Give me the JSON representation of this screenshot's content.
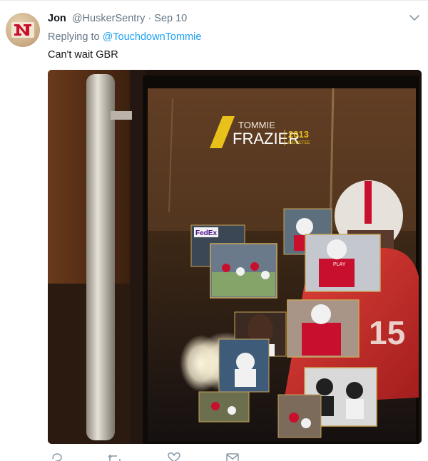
{
  "tweet": {
    "display_name": "Jon",
    "handle": "@HuskerSentry",
    "separator": "·",
    "date": "Sep 10",
    "replying_prefix": "Replying to",
    "replying_to": "@TouchdownTommie",
    "text": "Can't wait GBR"
  },
  "media": {
    "plaque": {
      "first_name": "TOMMIE",
      "last_name": "FRAZIER",
      "year": "2013",
      "inductee": "INDUCTEE"
    },
    "sign_text": "FedEx",
    "jersey_number": "15",
    "helmet_text": "PLAY"
  },
  "colors": {
    "link_blue": "#1da1f2",
    "secondary_gray": "#657786",
    "husker_red": "#c8102e",
    "plaque_gold": "#e8c21a"
  },
  "actions": [
    "reply-icon",
    "retweet-icon",
    "like-icon",
    "message-icon"
  ]
}
